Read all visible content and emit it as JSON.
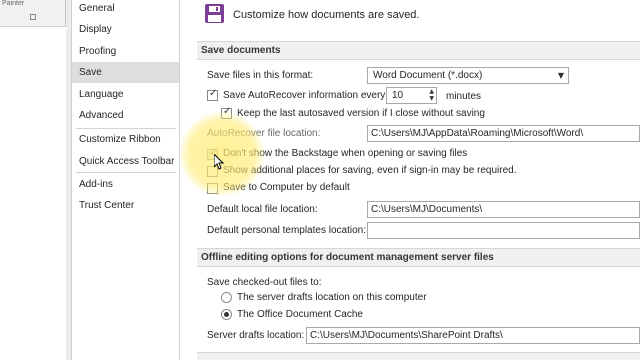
{
  "background_doc": {
    "ribbon_label": "Painter"
  },
  "nav": {
    "items": [
      "General",
      "Display",
      "Proofing",
      "Save",
      "Language",
      "Advanced",
      "Customize Ribbon",
      "Quick Access Toolbar",
      "Add-ins",
      "Trust Center"
    ],
    "selected": "Save"
  },
  "header": {
    "text": "Customize how documents are saved.",
    "icon": "floppy-disk-icon",
    "icon_color": "#7b3f98"
  },
  "save_documents": {
    "title": "Save documents",
    "format_label": "Save files in this format:",
    "format_value": "Word Document (*.docx)",
    "autorecover_label": "Save AutoRecover information every",
    "autorecover_minutes": "10",
    "minutes_label": "minutes",
    "keep_last_label": "Keep the last autosaved version if I close without saving",
    "autorecover_location_label": "AutoRecover file location:",
    "autorecover_location_value": "C:\\Users\\MJ\\AppData\\Roaming\\Microsoft\\Word\\",
    "backstage_label": "Don't show the Backstage when opening or saving files",
    "additional_places_label": "Show additional places for saving, even if sign-in may be required.",
    "save_to_computer_label": "Save to Computer by default",
    "default_local_label": "Default local file location:",
    "default_local_value": "C:\\Users\\MJ\\Documents\\",
    "default_personal_label": "Default personal templates location:",
    "default_personal_value": ""
  },
  "offline": {
    "title": "Offline editing options for document management server files",
    "checked_out_label": "Save checked-out files to:",
    "radio_server": "The server drafts location on this computer",
    "radio_cache": "The Office Document Cache",
    "server_drafts_label": "Server drafts location:",
    "server_drafts_value": "C:\\Users\\MJ\\Documents\\SharePoint Drafts\\"
  },
  "colors": {
    "accent": "#7b3f98",
    "nav_selected": "#dedede",
    "section_bar": "#f0f0f0",
    "highlight": "#ffec6e"
  }
}
